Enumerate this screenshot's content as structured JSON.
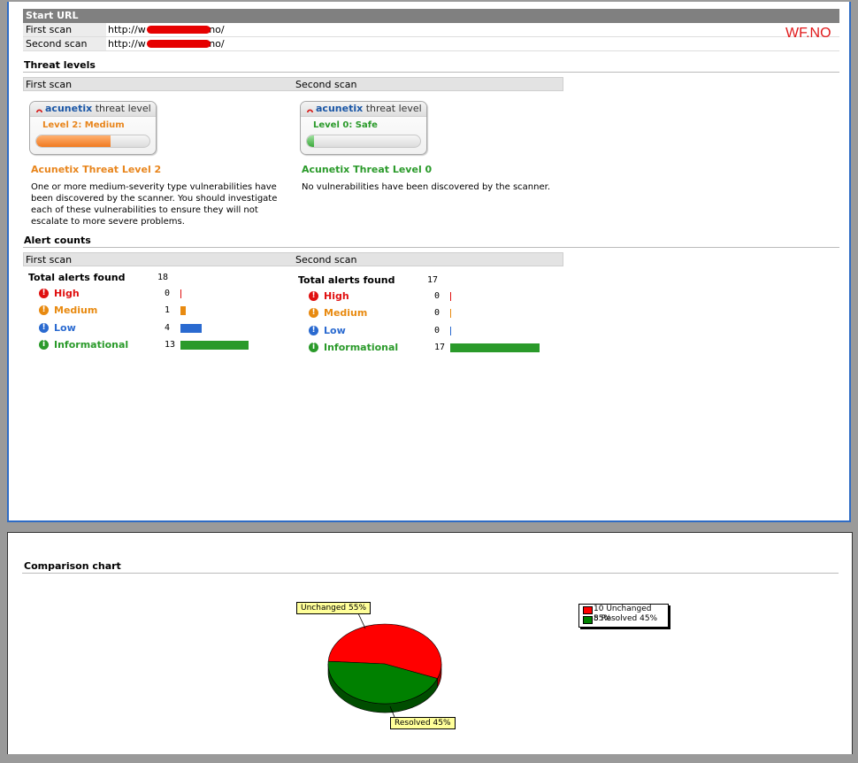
{
  "start_url": {
    "header": "Start URL",
    "rows": [
      {
        "label": "First scan",
        "prefix": "http://w",
        "suffix": ".no/"
      },
      {
        "label": "Second scan",
        "prefix": "http://w",
        "suffix": ".no/"
      }
    ],
    "watermark": "WF.NO"
  },
  "threat_levels": {
    "title": "Threat levels",
    "first_label": "First scan",
    "second_label": "Second scan",
    "badge_brand": "acunetix",
    "badge_tail": " threat level",
    "first": {
      "badge_level": "Level 2: Medium",
      "level_color": "#e8851c",
      "fill_percent": 66,
      "title": "Acunetix Threat Level 2",
      "description": "One or more medium-severity type vulnerabilities have been discovered by the scanner. You should investigate each of these vulnerabilities to ensure they will not escalate to more severe problems."
    },
    "second": {
      "badge_level": "Level 0: Safe",
      "level_color": "#2a9a2a",
      "fill_percent": 6,
      "title": "Acunetix Threat Level 0",
      "description": "No vulnerabilities have been discovered by the scanner."
    }
  },
  "alert_counts": {
    "title": "Alert counts",
    "first_label": "First scan",
    "second_label": "Second scan",
    "total_label": "Total alerts found",
    "first": {
      "total": "18",
      "items": [
        {
          "label": "High",
          "count": "0",
          "value": 0,
          "color": "#e01010",
          "icon": "!"
        },
        {
          "label": "Medium",
          "count": "1",
          "value": 1,
          "color": "#e88a10",
          "icon": "!"
        },
        {
          "label": "Low",
          "count": "4",
          "value": 4,
          "color": "#2a6ad0",
          "icon": "!"
        },
        {
          "label": "Informational",
          "count": "13",
          "value": 13,
          "color": "#2a9a2a",
          "icon": "i"
        }
      ]
    },
    "second": {
      "total": "17",
      "items": [
        {
          "label": "High",
          "count": "0",
          "value": 0,
          "color": "#e01010",
          "icon": "!"
        },
        {
          "label": "Medium",
          "count": "0",
          "value": 0,
          "color": "#e88a10",
          "icon": "!"
        },
        {
          "label": "Low",
          "count": "0",
          "value": 0,
          "color": "#2a6ad0",
          "icon": "!"
        },
        {
          "label": "Informational",
          "count": "17",
          "value": 17,
          "color": "#2a9a2a",
          "icon": "i"
        }
      ]
    }
  },
  "comparison": {
    "title": "Comparison chart"
  },
  "chart_data": {
    "type": "pie",
    "title": "",
    "slices": [
      {
        "label": "Unchanged",
        "count": 10,
        "percent": 55,
        "color": "#ff0000",
        "callout": "Unchanged 55%",
        "legend": "10 Unchanged 55%"
      },
      {
        "label": "Resolved",
        "count": 8,
        "percent": 45,
        "color": "#008000",
        "callout": "Resolved 45%",
        "legend": "8 Resolved 45%"
      }
    ],
    "legend_position": "right"
  }
}
